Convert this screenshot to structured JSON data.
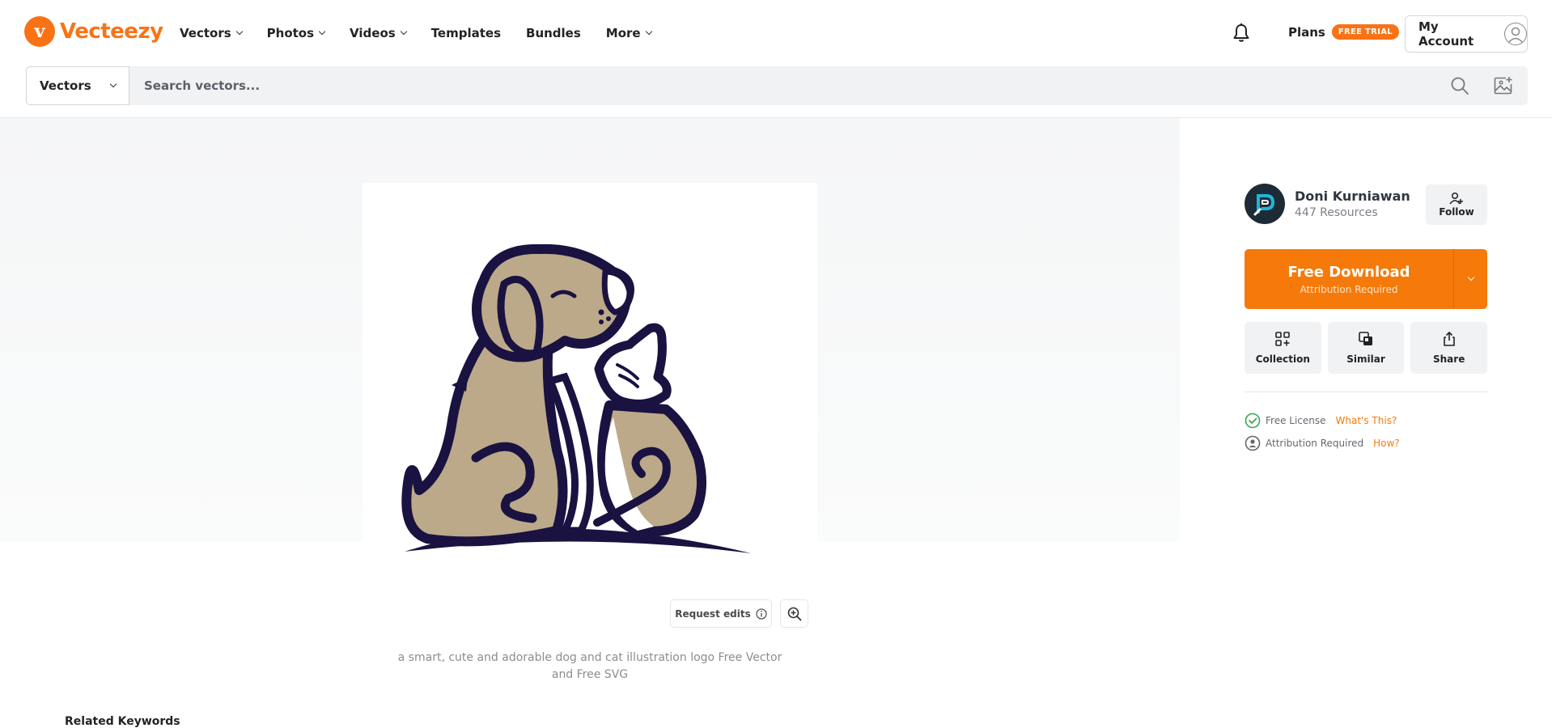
{
  "header": {
    "brand": "Vecteezy",
    "brand_glyph": "v",
    "nav": [
      {
        "label": "Vectors",
        "dropdown": true
      },
      {
        "label": "Photos",
        "dropdown": true
      },
      {
        "label": "Videos",
        "dropdown": true
      },
      {
        "label": "Templates",
        "dropdown": false
      },
      {
        "label": "Bundles",
        "dropdown": false
      },
      {
        "label": "More",
        "dropdown": true
      }
    ],
    "plans_label": "Plans",
    "trial_badge": "FREE TRIAL",
    "account_label": "My Account"
  },
  "search": {
    "category": "Vectors",
    "placeholder": "Search vectors..."
  },
  "main": {
    "request_edits": "Request edits",
    "caption": "a smart, cute and adorable dog and cat illustration logo Free Vector and Free SVG",
    "related_heading": "Related Keywords"
  },
  "sidebar": {
    "author_name": "Doni Kurniawan",
    "author_resources": "447 Resources",
    "follow_label": "Follow",
    "download_title": "Free Download",
    "download_sub": "Attribution Required",
    "actions": [
      {
        "label": "Collection",
        "icon": "collection-icon"
      },
      {
        "label": "Similar",
        "icon": "similar-icon"
      },
      {
        "label": "Share",
        "icon": "share-icon"
      }
    ],
    "license_label": "Free License",
    "license_link": "What's This?",
    "attribution_label": "Attribution Required",
    "attribution_link": "How?"
  },
  "colors": {
    "brand": "#f97316",
    "download": "#f57a0a",
    "illustration_outline": "#1a1240",
    "illustration_fill": "#bba98a",
    "license_check": "#3aa655"
  }
}
